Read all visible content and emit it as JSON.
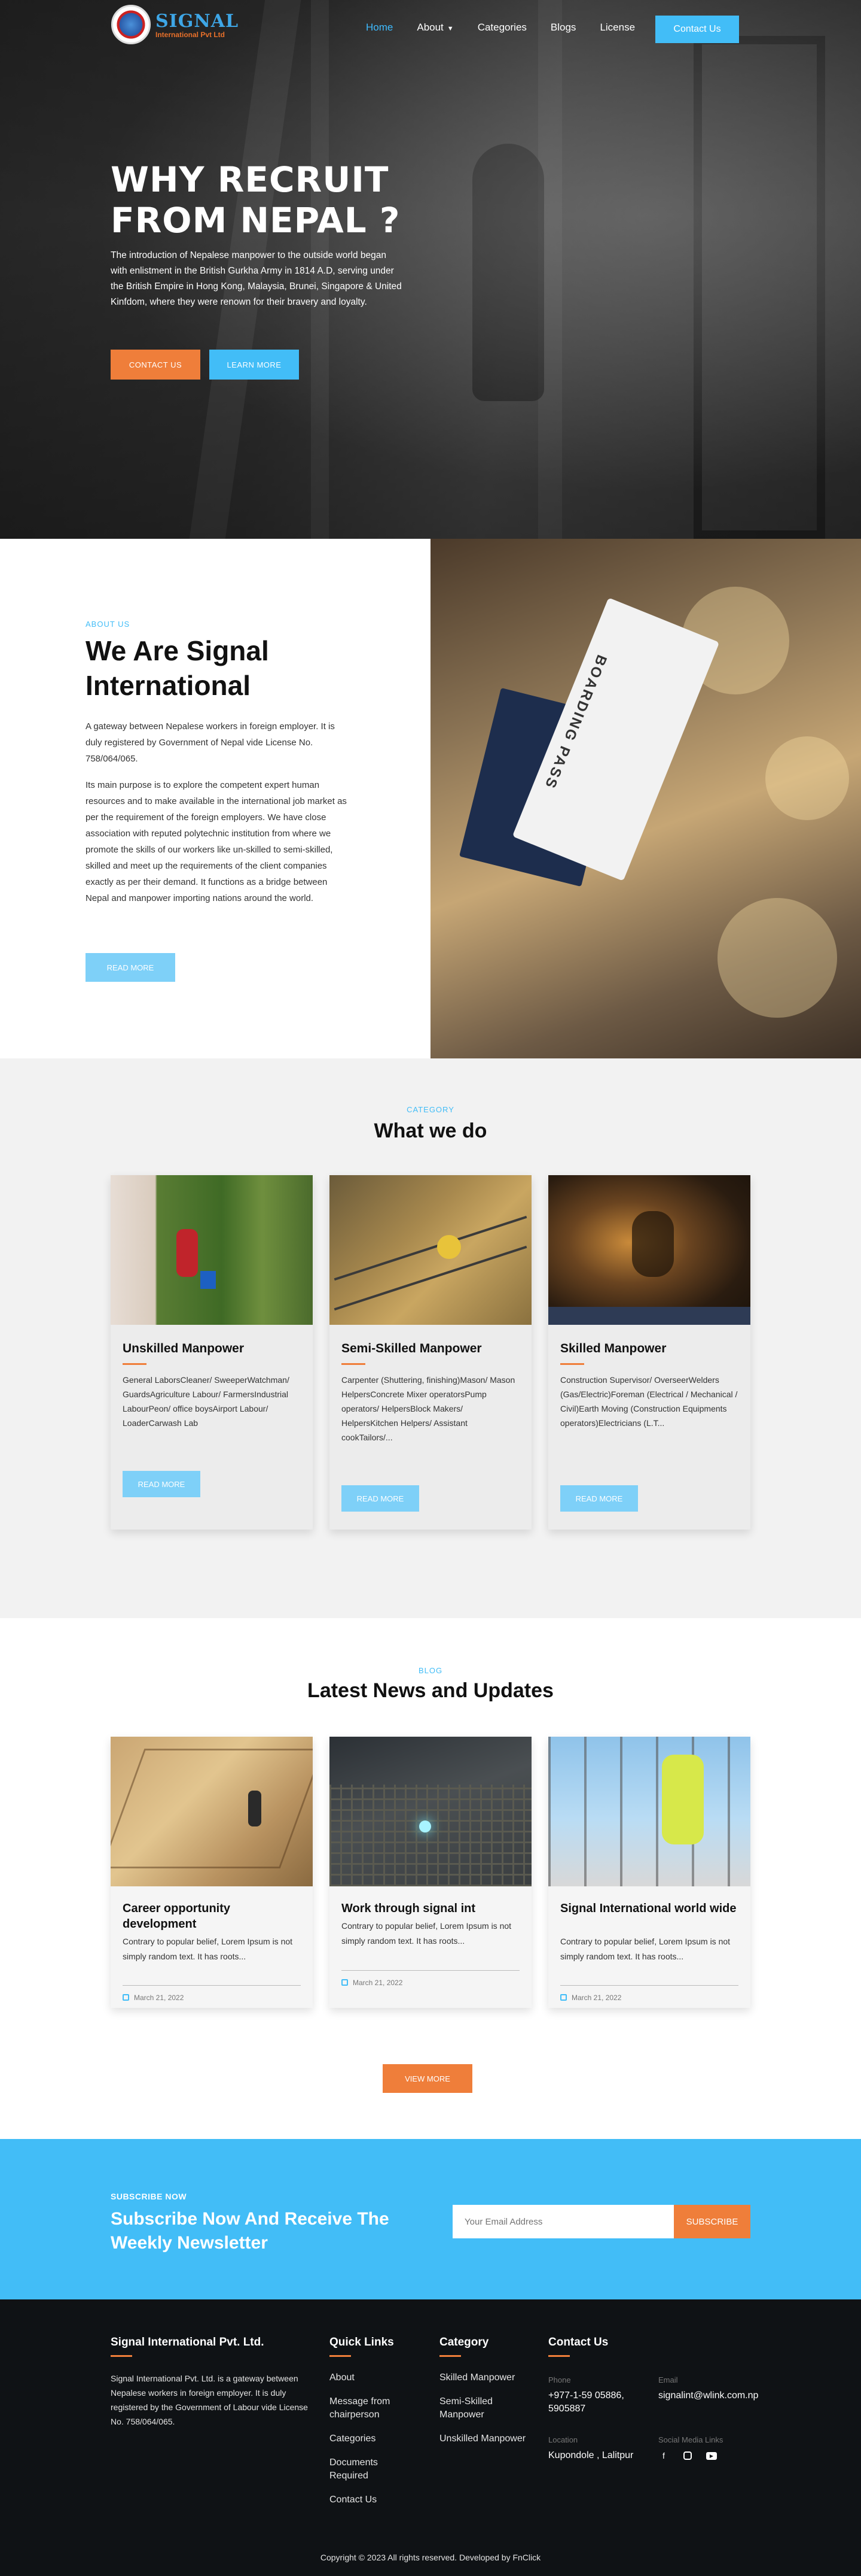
{
  "nav": {
    "logo_text": "SIGNAL",
    "logo_sub": "International Pvt Ltd",
    "links": [
      "Home",
      "About",
      "Categories",
      "Blogs",
      "License"
    ],
    "contact_label": "Contact Us"
  },
  "hero": {
    "title": "WHY RECRUIT FROM NEPAL ?",
    "text": "The introduction of Nepalese manpower to the outside world began with enlistment in the British Gurkha Army in 1814 A.D, serving under the British Empire in Hong Kong, Malaysia, Brunei, Singapore & United Kinfdom, where they were renown for their bravery and loyalty.",
    "btn_contact": "CONTACT US",
    "btn_learn": "LEARN MORE"
  },
  "about": {
    "eyebrow": "ABOUT US",
    "title": "We Are Signal International",
    "p1": "A gateway between Nepalese workers in foreign employer. It is duly registered by Government of Nepal vide License No. 758/064/065.",
    "p2": "Its main purpose is to explore the competent expert human resources and to make available in the international job market as per the requirement of the foreign employers. We have close association with reputed polytechnic institution from where we promote the skills of our workers like un-skilled to semi-skilled, skilled and meet up the requirements of the client companies exactly as per their demand. It functions as a bridge between Nepal and manpower importing nations around the world.",
    "btn": "READ MORE",
    "photo_text": "BOARDING PASS"
  },
  "what": {
    "eyebrow": "CATEGORY",
    "title": "What we do",
    "cards": [
      {
        "title": "Unskilled Manpower",
        "desc": "General LaborsCleaner/ SweeperWatchman/ GuardsAgriculture Labour/ FarmersIndustrial LabourPeon/ office boysAirport Labour/ LoaderCarwash Lab",
        "btn": "READ MORE"
      },
      {
        "title": "Semi-Skilled Manpower",
        "desc": "Carpenter (Shuttering, finishing)Mason/ Mason HelpersConcrete Mixer operatorsPump operators/ HelpersBlock Makers/ HelpersKitchen Helpers/ Assistant cookTailors/...",
        "btn": "READ MORE"
      },
      {
        "title": "Skilled Manpower",
        "desc": "Construction Supervisor/ OverseerWelders (Gas/Electric)Foreman (Electrical / Mechanical / Civil)Earth Moving (Construction Equipments operators)Electricians (L.T...",
        "btn": "READ MORE"
      }
    ]
  },
  "news": {
    "eyebrow": "BLOG",
    "title": "Latest News and Updates",
    "cards": [
      {
        "title": "Career opportunity development",
        "desc": "Contrary to popular belief, Lorem Ipsum is not simply random text. It has roots...",
        "date": "March 21, 2022"
      },
      {
        "title": "Work through signal int",
        "desc": "Contrary to popular belief, Lorem Ipsum is not simply random text. It has roots...",
        "date": "March 21, 2022"
      },
      {
        "title": "Signal International world wide",
        "desc": "Contrary to popular belief, Lorem Ipsum is not simply random text. It has roots...",
        "date": "March 21, 2022"
      }
    ],
    "view_more": "VIEW MORE"
  },
  "subscribe": {
    "eyebrow": "SUBSCRIBE NOW",
    "title": "Subscribe Now And Receive The Weekly Newsletter",
    "placeholder": "Your Email Address",
    "btn": "SUBSCRIBE"
  },
  "footer": {
    "company_title": "Signal International Pvt. Ltd.",
    "company_text": "Signal International Pvt. Ltd. is a gateway between Nepalese workers in foreign employer. It is duly registered by the Government of Labour vide License No. 758/064/065.",
    "quick_title": "Quick Links",
    "quick_links": [
      "About",
      "Message from chairperson",
      "Categories",
      "Documents Required",
      "Contact Us"
    ],
    "category_title": "Category",
    "categories": [
      "Skilled Manpower",
      "Semi-Skilled Manpower",
      "Unskilled Manpower"
    ],
    "contact_title": "Contact Us",
    "phone_label": "Phone",
    "phone": "+977-1-59 05886, 5905887",
    "email_label": "Email",
    "email": "signalint@wlink.com.np",
    "location_label": "Location",
    "location": "Kupondole , Lalitpur",
    "social_label": "Social Media Links",
    "copyright": "Copyright © 2023 All rights reserved. Developed by FnClick"
  }
}
